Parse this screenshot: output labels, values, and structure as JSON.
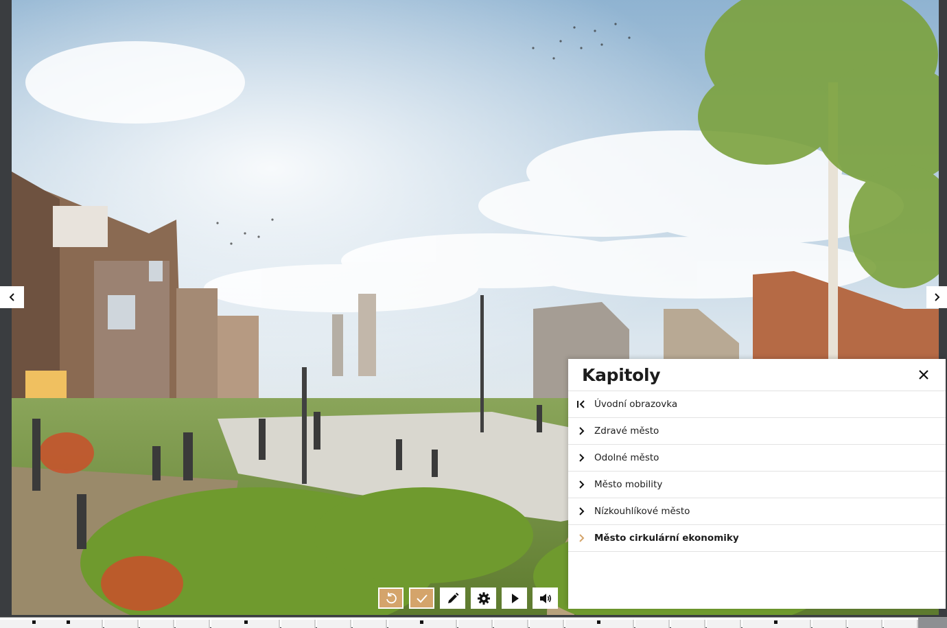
{
  "panel": {
    "title": "Kapitoly",
    "items": [
      {
        "label": "Úvodní obrazovka",
        "icon": "first-page-icon"
      },
      {
        "label": "Zdravé město",
        "icon": "chevron-right-icon"
      },
      {
        "label": "Odolné město",
        "icon": "chevron-right-icon"
      },
      {
        "label": "Město mobility",
        "icon": "chevron-right-icon"
      },
      {
        "label": "Nízkouhlíkové město",
        "icon": "chevron-right-icon"
      },
      {
        "label": "Město cirkulární ekonomiky",
        "icon": "chevron-right-icon",
        "active": true
      }
    ]
  },
  "toolbar": {
    "buttons": [
      "undo-icon",
      "check-icon",
      "pencil-icon",
      "gear-icon",
      "play-icon",
      "volume-icon"
    ]
  },
  "colors": {
    "accent": "#d4a46b",
    "active_chevron": "#d4a46b",
    "panel_bg": "#ffffff",
    "page_bg": "#3a3d40"
  }
}
